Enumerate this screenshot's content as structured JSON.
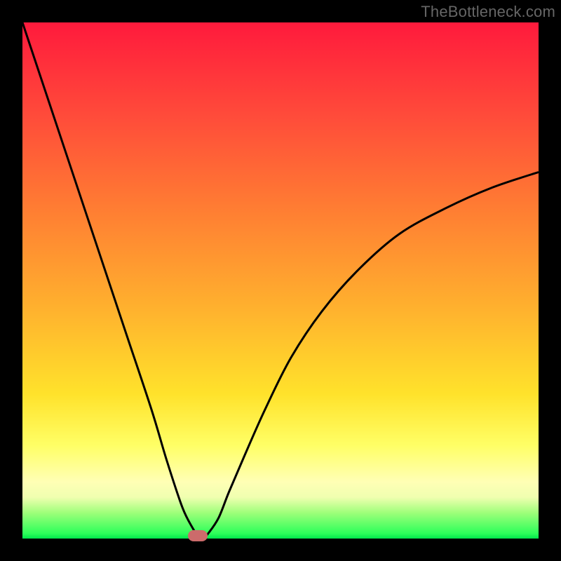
{
  "attribution": "TheBottleneck.com",
  "chart_data": {
    "type": "line",
    "title": "",
    "xlabel": "",
    "ylabel": "",
    "xlim": [
      0,
      100
    ],
    "ylim": [
      0,
      100
    ],
    "x": [
      0,
      5,
      10,
      15,
      20,
      25,
      28,
      31,
      33,
      34,
      35,
      36,
      38,
      40,
      43,
      47,
      52,
      58,
      65,
      73,
      82,
      91,
      100
    ],
    "values": [
      100,
      85,
      70,
      55,
      40,
      25,
      15,
      6,
      2,
      0.5,
      0,
      1,
      4,
      9,
      16,
      25,
      35,
      44,
      52,
      59,
      64,
      68,
      71
    ],
    "min_point": {
      "x": 34,
      "y": 0
    },
    "marker": {
      "x": 34,
      "y": 0.5,
      "color": "#cc6b6b"
    },
    "gradient_stops": [
      {
        "pos": 0,
        "color": "#ff1a3c"
      },
      {
        "pos": 55,
        "color": "#ffb02e"
      },
      {
        "pos": 82,
        "color": "#ffff66"
      },
      {
        "pos": 100,
        "color": "#00e64b"
      }
    ]
  },
  "colors": {
    "curve": "#000000",
    "frame": "#000000",
    "marker": "#cc6b6b",
    "attribution": "#666666"
  }
}
